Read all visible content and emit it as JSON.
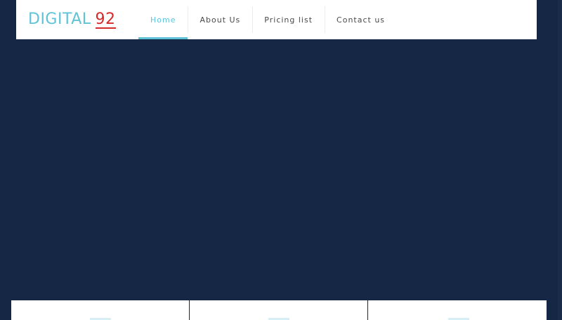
{
  "logo": {
    "main": "DIGITAL",
    "number": "92"
  },
  "nav": {
    "items": [
      {
        "label": "Home",
        "active": true
      },
      {
        "label": "About Us",
        "active": false
      },
      {
        "label": "Pricing list",
        "active": false
      },
      {
        "label": "Contact us",
        "active": false
      }
    ]
  },
  "colors": {
    "page_background": "#162746",
    "header_background": "#ffffff",
    "accent": "#5fc3d8",
    "logo_number": "#d42b2b",
    "nav_text": "#4a4a4a"
  },
  "cards": [
    {
      "icon": "feature-icon"
    },
    {
      "icon": "feature-icon"
    },
    {
      "icon": "feature-icon"
    }
  ]
}
